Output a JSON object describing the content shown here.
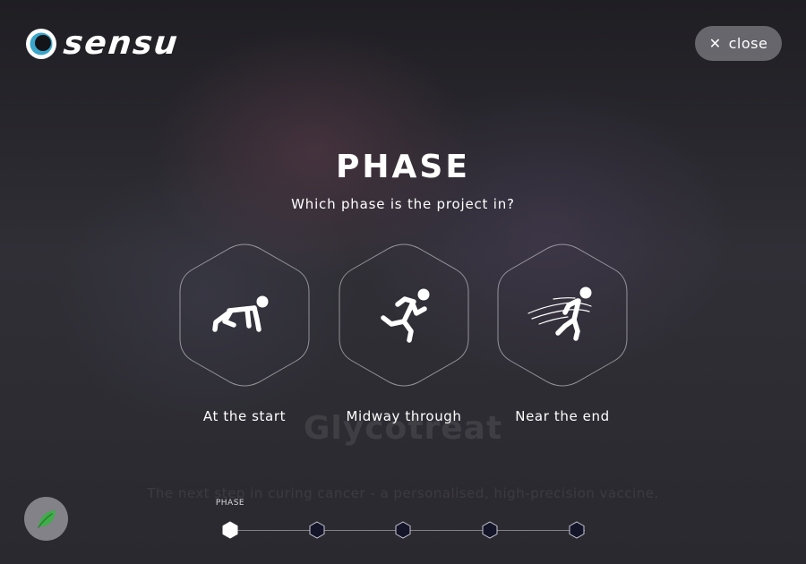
{
  "brand": {
    "name": "sensu",
    "accent": "#3aa6c9"
  },
  "close_button": {
    "icon": "close-icon",
    "label": "close"
  },
  "background": {
    "title": "Glycotreat",
    "subtitle": "The next step in curing cancer - a personalised, high-precision vaccine."
  },
  "question": {
    "title": "PHASE",
    "prompt": "Which phase is the project in?"
  },
  "options": [
    {
      "label": "At the start",
      "icon": "crouching-start-icon"
    },
    {
      "label": "Midway through",
      "icon": "running-person-icon"
    },
    {
      "label": "Near the end",
      "icon": "finish-line-runner-icon"
    }
  ],
  "progress": {
    "current_label": "PHASE",
    "current_step": 1,
    "total_steps": 5
  },
  "leaf_button": {
    "icon": "leaf-icon"
  }
}
